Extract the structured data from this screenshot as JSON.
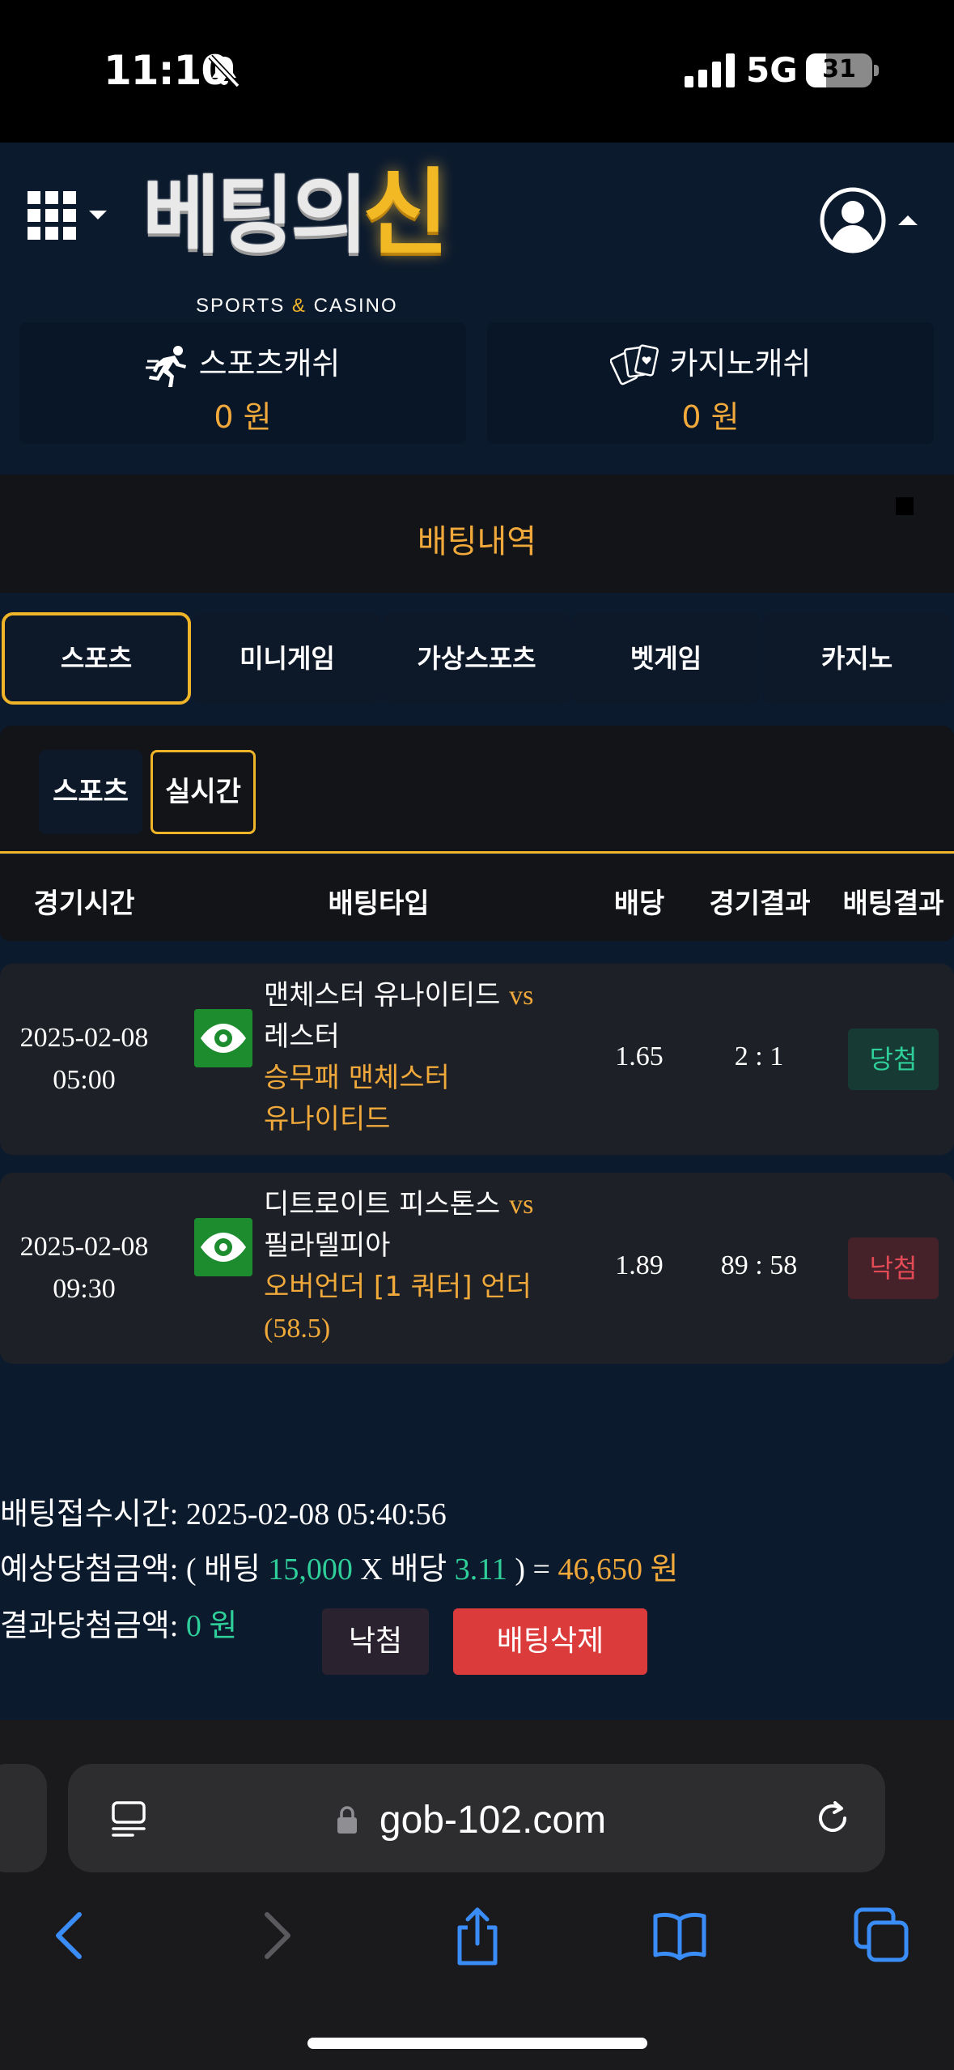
{
  "status_bar": {
    "time": "11:10",
    "network": "5G",
    "battery": "31",
    "battery_level": 0.31
  },
  "header": {
    "logo_main": "베팅의",
    "logo_accent": "신",
    "logo_sub_left": "SPORTS",
    "logo_sub_amp": "&",
    "logo_sub_right": "CASINO",
    "sports_cash_label": "스포츠캐쉬",
    "sports_cash_value": "0 원",
    "casino_cash_label": "카지노캐쉬",
    "casino_cash_value": "0 원"
  },
  "page_title": "배팅내역",
  "tabs": [
    {
      "label": "스포츠",
      "active": true
    },
    {
      "label": "미니게임",
      "active": false
    },
    {
      "label": "가상스포츠",
      "active": false
    },
    {
      "label": "벳게임",
      "active": false
    },
    {
      "label": "카지노",
      "active": false
    }
  ],
  "subtabs": [
    {
      "label": "스포츠",
      "active": false
    },
    {
      "label": "실시간",
      "active": true
    }
  ],
  "table": {
    "headers": [
      "경기시간",
      "배팅타입",
      "배당",
      "경기결과",
      "배팅결과"
    ],
    "rows": [
      {
        "date": "2025-02-08",
        "time": "05:00",
        "home": "맨체스터 유나이티드",
        "vs": "vs",
        "away": "레스터",
        "pick_line1": "승무패 맨체스터",
        "pick_line2": "유나이티드",
        "odds": "1.65",
        "score": "2 : 1",
        "result": "당첨"
      },
      {
        "date": "2025-02-08",
        "time": "09:30",
        "home": "디트로이트 피스톤스",
        "vs": "vs",
        "away": "필라델피아",
        "pick_line1": "오버언더 [1 쿼터] 언더",
        "pick_line2": "(58.5)",
        "odds": "1.89",
        "score": "89 : 58",
        "result": "낙첨"
      }
    ]
  },
  "summary": {
    "received_label": "배팅접수시간:",
    "received_value": "2025-02-08 05:40:56",
    "expected_label": "예상당첨금액:",
    "expected_open": "( 배팅",
    "stake": "15,000",
    "times": "X 배당",
    "total_odds": "3.11",
    "close_eq": ") =",
    "expected_amount": "46,650 원",
    "result_label": "결과당첨금액:",
    "result_amount": "0 원",
    "status_button": "낙첨",
    "delete_button": "배팅삭제"
  },
  "browser": {
    "url": "gob-102.com"
  },
  "colors": {
    "accent": "#f0b429",
    "win": "#2fcf9a",
    "lose": "#e24a55",
    "delete": "#dc3b3b",
    "header_bg": "#0c1a2e"
  }
}
